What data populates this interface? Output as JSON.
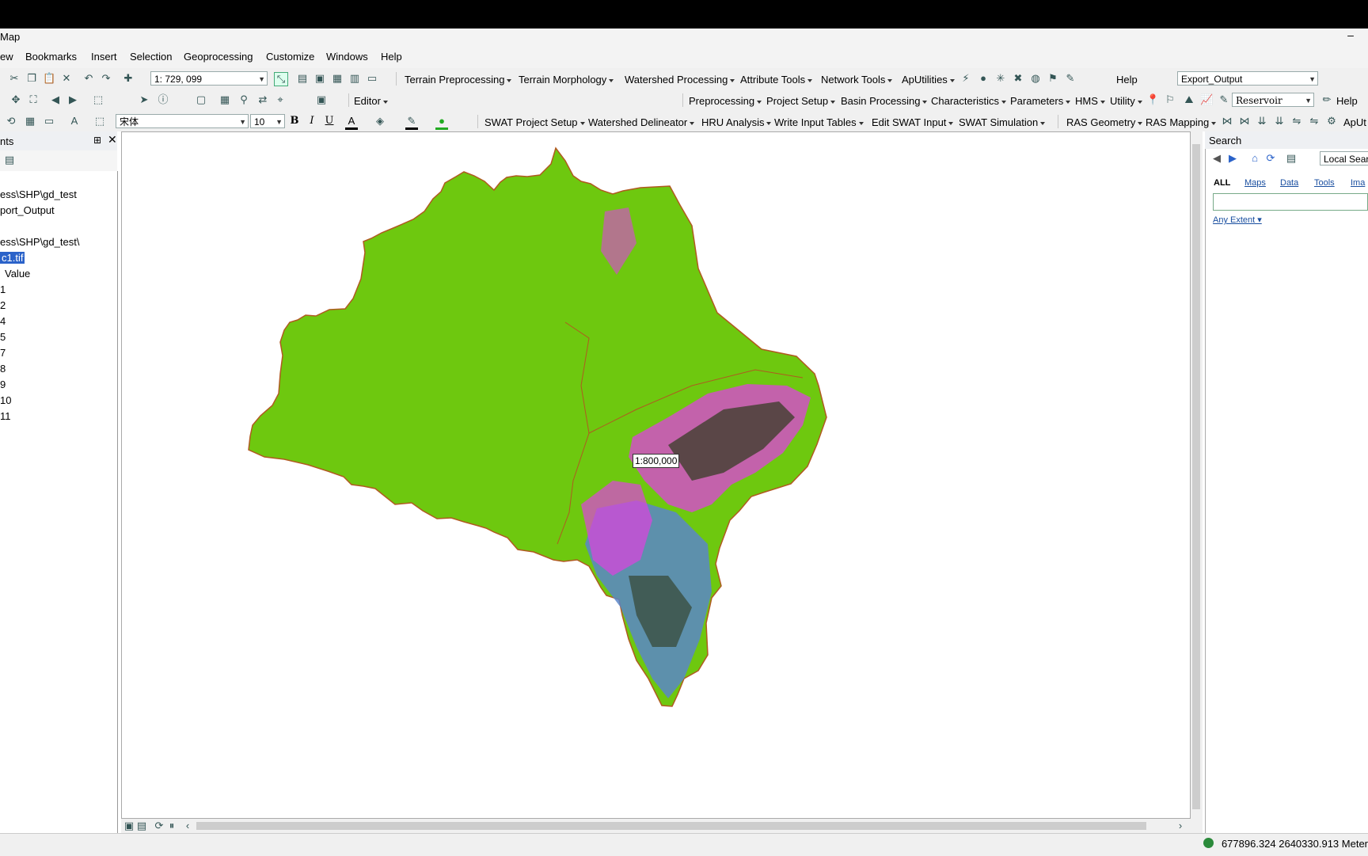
{
  "app": {
    "title": "Map",
    "minimize": "–"
  },
  "menu": [
    "ew",
    "Bookmarks",
    "Insert",
    "Selection",
    "Geoprocessing",
    "Customize",
    "Windows",
    "Help"
  ],
  "toolbar1": {
    "scale_value": "1: 729, 099",
    "items": [
      "Terrain Preprocessing",
      "Terrain Morphology",
      "Watershed Processing",
      "Attribute Tools",
      "Network Tools",
      "ApUtilities"
    ],
    "help": "Help",
    "layer_combo": "Export_Output"
  },
  "toolbar2": {
    "editor": "Editor",
    "items": [
      "Preprocessing",
      "Project Setup",
      "Basin Processing",
      "Characteristics",
      "Parameters",
      "HMS",
      "Utility"
    ],
    "reservoir_combo": "Reservoir",
    "help": "Help"
  },
  "toolbar3": {
    "font_name": "宋体",
    "font_size": "10",
    "bold": "B",
    "italic": "I",
    "underline": "U",
    "font_color": "A",
    "items": [
      "SWAT Project Setup",
      "Watershed Delineator",
      "HRU Analysis",
      "Write Input Tables",
      "Edit SWAT Input",
      "SWAT Simulation",
      "RAS Geometry",
      "RAS Mapping"
    ],
    "aputil": "ApUt"
  },
  "toc": {
    "title": "nts",
    "pin": "⊞",
    "close": "✕",
    "lines": [
      "ess\\SHP\\gd_test",
      "port_Output",
      "ess\\SHP\\gd_test\\",
      "c1.tif",
      "Value",
      "1",
      "2",
      "4",
      "5",
      "7",
      "8",
      "9",
      "10",
      "11"
    ]
  },
  "map": {
    "scale_label": "1:800,000"
  },
  "search": {
    "title": "Search",
    "local": "Local Sear",
    "tabs": [
      "ALL",
      "Maps",
      "Data",
      "Tools",
      "Ima"
    ],
    "any_extent": "Any Extent ▾"
  },
  "status": {
    "coords": "677896.324   2640330.913 Meter"
  },
  "colors": {
    "land_green": "#6ec80f",
    "urban_magenta": "#e040e0",
    "water_blue": "#5b86c8",
    "forest_dark": "#2e3a1c",
    "boundary": "#b05a20"
  }
}
